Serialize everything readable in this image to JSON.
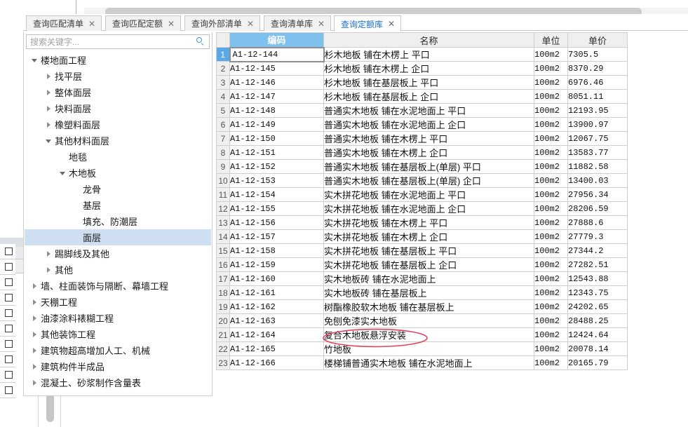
{
  "window": {
    "title": "查询定额库"
  },
  "tabs": [
    {
      "label": "查询匹配清单",
      "close": "✕",
      "active": false
    },
    {
      "label": "查询匹配定额",
      "close": "✕",
      "active": false
    },
    {
      "label": "查询外部清单",
      "close": "✕",
      "active": false
    },
    {
      "label": "查询清单库",
      "close": "✕",
      "active": false
    },
    {
      "label": "查询定额库",
      "close": "✕",
      "active": true
    }
  ],
  "search": {
    "placeholder": "搜索关键字...",
    "value": "",
    "icon": "search-icon"
  },
  "tree": [
    {
      "label": "楼地面工程",
      "indent": 0,
      "state": "expanded",
      "selected": false
    },
    {
      "label": "找平层",
      "indent": 1,
      "state": "collapsed",
      "selected": false
    },
    {
      "label": "整体面层",
      "indent": 1,
      "state": "collapsed",
      "selected": false
    },
    {
      "label": "块料面层",
      "indent": 1,
      "state": "collapsed",
      "selected": false
    },
    {
      "label": "橡塑料面层",
      "indent": 1,
      "state": "collapsed",
      "selected": false
    },
    {
      "label": "其他材料面层",
      "indent": 1,
      "state": "expanded",
      "selected": false
    },
    {
      "label": "地毯",
      "indent": 2,
      "state": "leaf",
      "selected": false
    },
    {
      "label": "木地板",
      "indent": 2,
      "state": "expanded",
      "selected": false
    },
    {
      "label": "龙骨",
      "indent": 3,
      "state": "leaf",
      "selected": false
    },
    {
      "label": "基层",
      "indent": 3,
      "state": "leaf",
      "selected": false
    },
    {
      "label": "填充、防潮层",
      "indent": 3,
      "state": "leaf",
      "selected": false
    },
    {
      "label": "面层",
      "indent": 3,
      "state": "leaf",
      "selected": true
    },
    {
      "label": "踢脚线及其他",
      "indent": 1,
      "state": "collapsed",
      "selected": false
    },
    {
      "label": "其他",
      "indent": 1,
      "state": "collapsed",
      "selected": false
    },
    {
      "label": "墙、柱面装饰与隔断、幕墙工程",
      "indent": 0,
      "state": "collapsed",
      "selected": false
    },
    {
      "label": "天棚工程",
      "indent": 0,
      "state": "collapsed",
      "selected": false
    },
    {
      "label": "油漆涂料裱糊工程",
      "indent": 0,
      "state": "collapsed",
      "selected": false
    },
    {
      "label": "其他装饰工程",
      "indent": 0,
      "state": "collapsed",
      "selected": false
    },
    {
      "label": "建筑物超高增加人工、机械",
      "indent": 0,
      "state": "collapsed",
      "selected": false
    },
    {
      "label": "建筑构件半成品",
      "indent": 0,
      "state": "collapsed",
      "selected": false
    },
    {
      "label": "混凝土、砂浆制作含量表",
      "indent": 0,
      "state": "collapsed",
      "selected": false
    }
  ],
  "table": {
    "columns": [
      "",
      "编码",
      "名称",
      "单位",
      "单价"
    ],
    "selected_column": "编码",
    "selected_row_index": 1,
    "rows": [
      {
        "idx": "1",
        "code": "A1-12-144",
        "name": "杉木地板 铺在木楞上 平口",
        "unit": "100m2",
        "price": "7305.5"
      },
      {
        "idx": "2",
        "code": "A1-12-145",
        "name": "杉木地板 铺在木楞上 企口",
        "unit": "100m2",
        "price": "8370.29"
      },
      {
        "idx": "3",
        "code": "A1-12-146",
        "name": "杉木地板 铺在基层板上 平口",
        "unit": "100m2",
        "price": "6976.46"
      },
      {
        "idx": "4",
        "code": "A1-12-147",
        "name": "杉木地板 铺在基层板上 企口",
        "unit": "100m2",
        "price": "8051.11"
      },
      {
        "idx": "5",
        "code": "A1-12-148",
        "name": "普通实木地板 铺在水泥地面上 平口",
        "unit": "100m2",
        "price": "12193.95"
      },
      {
        "idx": "6",
        "code": "A1-12-149",
        "name": "普通实木地板 铺在水泥地面上 企口",
        "unit": "100m2",
        "price": "13900.97"
      },
      {
        "idx": "7",
        "code": "A1-12-150",
        "name": "普通实木地板 铺在木楞上 平口",
        "unit": "100m2",
        "price": "12067.75"
      },
      {
        "idx": "8",
        "code": "A1-12-151",
        "name": "普通实木地板 铺在木楞上 企口",
        "unit": "100m2",
        "price": "13583.77"
      },
      {
        "idx": "9",
        "code": "A1-12-152",
        "name": "普通实木地板 铺在基层板上(单层) 平口",
        "unit": "100m2",
        "price": "11882.58"
      },
      {
        "idx": "10",
        "code": "A1-12-153",
        "name": "普通实木地板 铺在基层板上(单层) 企口",
        "unit": "100m2",
        "price": "13400.03"
      },
      {
        "idx": "11",
        "code": "A1-12-154",
        "name": "实木拼花地板 铺在水泥地面上 平口",
        "unit": "100m2",
        "price": "27956.34"
      },
      {
        "idx": "12",
        "code": "A1-12-155",
        "name": "实木拼花地板 铺在水泥地面上 企口",
        "unit": "100m2",
        "price": "28206.59"
      },
      {
        "idx": "13",
        "code": "A1-12-156",
        "name": "实木拼花地板 铺在木楞上 平口",
        "unit": "100m2",
        "price": "27888.6"
      },
      {
        "idx": "14",
        "code": "A1-12-157",
        "name": "实木拼花地板 铺在木楞上 企口",
        "unit": "100m2",
        "price": "27779.3"
      },
      {
        "idx": "15",
        "code": "A1-12-158",
        "name": "实木拼花地板 铺在基层板上 平口",
        "unit": "100m2",
        "price": "27344.2"
      },
      {
        "idx": "16",
        "code": "A1-12-159",
        "name": "实木拼花地板 铺在基层板上 企口",
        "unit": "100m2",
        "price": "27282.51"
      },
      {
        "idx": "17",
        "code": "A1-12-160",
        "name": "实木地板砖 铺在水泥地面上",
        "unit": "100m2",
        "price": "12543.88"
      },
      {
        "idx": "18",
        "code": "A1-12-161",
        "name": "实木地板砖 铺在基层板上",
        "unit": "100m2",
        "price": "12343.75"
      },
      {
        "idx": "19",
        "code": "A1-12-162",
        "name": "树酯橡胶软木地板 铺在基层板上",
        "unit": "100m2",
        "price": "24202.65"
      },
      {
        "idx": "20",
        "code": "A1-12-163",
        "name": "免刨免漆实木地板",
        "unit": "100m2",
        "price": "28488.25"
      },
      {
        "idx": "21",
        "code": "A1-12-164",
        "name": "复合木地板悬浮安装",
        "unit": "100m2",
        "price": "12424.64"
      },
      {
        "idx": "22",
        "code": "A1-12-165",
        "name": "竹地板",
        "unit": "100m2",
        "price": "20078.14"
      },
      {
        "idx": "23",
        "code": "A1-12-166",
        "name": "楼梯铺普通实木地板 铺在水泥地面上",
        "unit": "100m2",
        "price": "20165.79"
      }
    ]
  },
  "annotation": {
    "shape": "ellipse",
    "color": "#e8405a",
    "targets_row": "21",
    "targets_text": "复合木地板悬浮安装"
  },
  "colors": {
    "header_blue": "#7ec1ef",
    "selected_row_blue": "#5aa9e6",
    "tree_selected": "#cddff0",
    "active_tab_text": "#1a73c8",
    "annotation_red": "#e8405a"
  }
}
